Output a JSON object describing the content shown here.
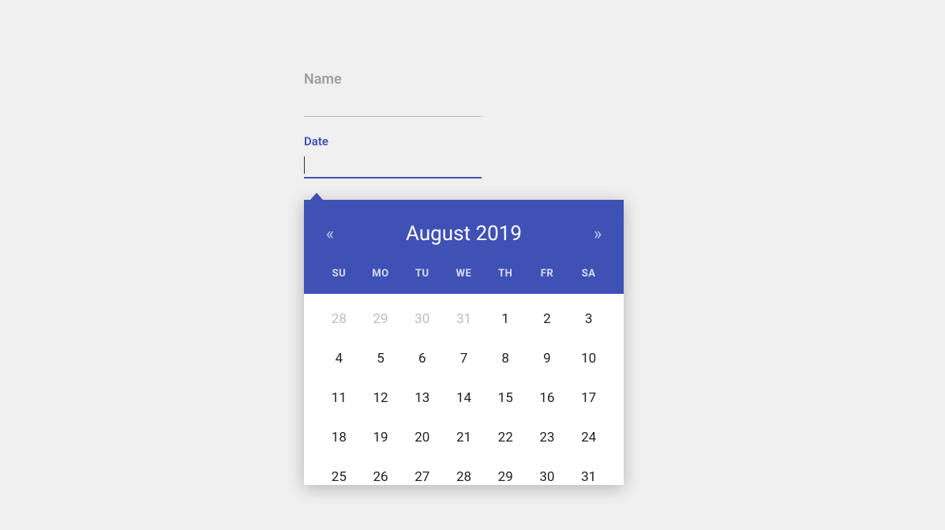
{
  "form": {
    "name_label": "Name",
    "name_value": "",
    "date_label": "Date",
    "date_value": ""
  },
  "datepicker": {
    "prev_symbol": "«",
    "next_symbol": "»",
    "month_year": "August 2019",
    "dow": [
      "SU",
      "MO",
      "TU",
      "WE",
      "TH",
      "FR",
      "SA"
    ],
    "days": [
      {
        "n": 28,
        "other": true
      },
      {
        "n": 29,
        "other": true
      },
      {
        "n": 30,
        "other": true
      },
      {
        "n": 31,
        "other": true
      },
      {
        "n": 1,
        "other": false
      },
      {
        "n": 2,
        "other": false
      },
      {
        "n": 3,
        "other": false
      },
      {
        "n": 4,
        "other": false
      },
      {
        "n": 5,
        "other": false
      },
      {
        "n": 6,
        "other": false
      },
      {
        "n": 7,
        "other": false
      },
      {
        "n": 8,
        "other": false
      },
      {
        "n": 9,
        "other": false
      },
      {
        "n": 10,
        "other": false
      },
      {
        "n": 11,
        "other": false
      },
      {
        "n": 12,
        "other": false
      },
      {
        "n": 13,
        "other": false
      },
      {
        "n": 14,
        "other": false
      },
      {
        "n": 15,
        "other": false
      },
      {
        "n": 16,
        "other": false
      },
      {
        "n": 17,
        "other": false
      },
      {
        "n": 18,
        "other": false
      },
      {
        "n": 19,
        "other": false
      },
      {
        "n": 20,
        "other": false
      },
      {
        "n": 21,
        "other": false
      },
      {
        "n": 22,
        "other": false
      },
      {
        "n": 23,
        "other": false
      },
      {
        "n": 24,
        "other": false
      },
      {
        "n": 25,
        "other": false
      },
      {
        "n": 26,
        "other": false
      },
      {
        "n": 27,
        "other": false
      },
      {
        "n": 28,
        "other": false
      },
      {
        "n": 29,
        "other": false
      },
      {
        "n": 30,
        "other": false
      },
      {
        "n": 31,
        "other": false
      }
    ]
  },
  "colors": {
    "primary": "#3f51b5"
  }
}
